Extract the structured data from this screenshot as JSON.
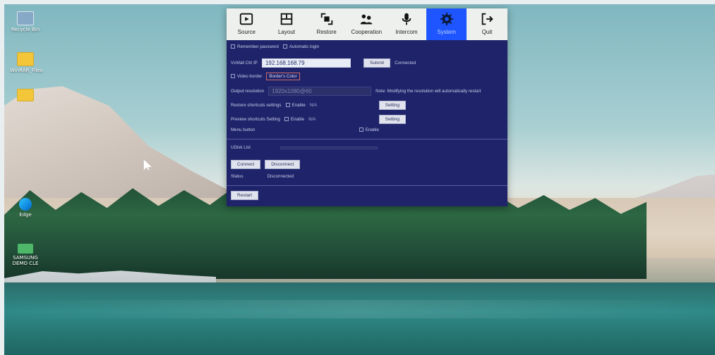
{
  "desktop": {
    "icons": [
      {
        "name": "Recycle Bin",
        "label": "Recycle Bin"
      },
      {
        "name": "Folder 1",
        "label": "WinRAR_Files"
      },
      {
        "name": "Folder 2",
        "label": ""
      },
      {
        "name": "Edge",
        "label": "Edge"
      },
      {
        "name": "App",
        "label": "SAMSUNG\nDEMO CLE"
      }
    ]
  },
  "toolbar": {
    "items": [
      {
        "label": "Source",
        "icon": "play-icon"
      },
      {
        "label": "Layout",
        "icon": "layout-icon"
      },
      {
        "label": "Restore",
        "icon": "restore-icon"
      },
      {
        "label": "Cooperation",
        "icon": "cooperation-icon"
      },
      {
        "label": "Intercom",
        "icon": "microphone-icon"
      },
      {
        "label": "System",
        "icon": "gear-icon",
        "active": true
      },
      {
        "label": "Quit",
        "icon": "quit-icon"
      }
    ]
  },
  "system": {
    "remember_password": "Remember password",
    "auto_login": "Automatic login",
    "ctrl_ip_label": "VxWall Ctrl IP",
    "ctrl_ip_value": "192.168.168.79",
    "submit": "Submit",
    "connected": "Connected",
    "video_border": "Video border",
    "border_color": "Border's Color",
    "output_resolution_label": "Output resolution",
    "output_resolution_value": "1920x1080@60",
    "resolution_note": "Note: Modifying the resolution will automatically restart",
    "restore_shortcuts_label": "Restore shortcuts settings",
    "preview_shortcuts_label": "Preview shortcuts Setting",
    "enable": "Enable",
    "na": "N/A",
    "setting": "Setting",
    "menu_button": "Menu button",
    "menu_enable": "Enable",
    "udisk_list": "UDisk List",
    "connect": "Connect",
    "disconnect": "Disconnect",
    "status_label": "Status",
    "status_value": "Disconnected",
    "restart": "Restart"
  },
  "colors": {
    "panel_bg": "#1f246a",
    "toolbar_bg": "#eef0ee",
    "active_tab": "#1f55ff",
    "border_color_outline": "#d06b6b"
  }
}
